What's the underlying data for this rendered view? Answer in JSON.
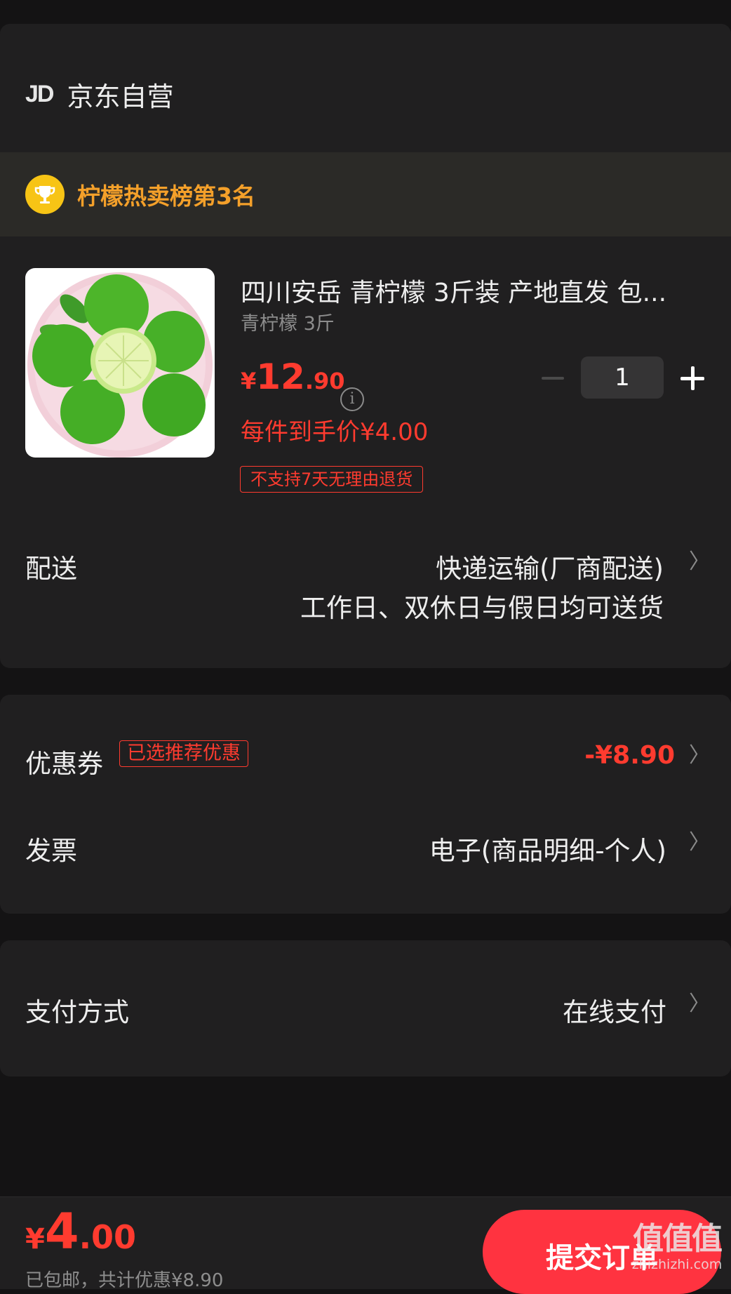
{
  "store": {
    "logo": "JD",
    "name": "京东自营"
  },
  "ranking": {
    "text": "柠檬热卖榜第3名"
  },
  "product": {
    "image_alt": "青柠檬",
    "title": "四川安岳 青柠檬 3斤装 产地直发 包...",
    "spec": "青柠檬 3斤",
    "price_symbol": "¥",
    "price_int": "12",
    "price_dec": ".90",
    "unit_price": "每件到手价¥4.00",
    "return_tag": "不支持7天无理由退货",
    "quantity": "1"
  },
  "delivery": {
    "label": "配送",
    "method": "快递运输(厂商配送)",
    "schedule": "工作日、双休日与假日均可送货"
  },
  "coupon": {
    "label": "优惠券",
    "tag": "已选推荐优惠",
    "value": "-¥8.90"
  },
  "invoice": {
    "label": "发票",
    "value": "电子(商品明细-个人)"
  },
  "payment": {
    "label": "支付方式",
    "value": "在线支付"
  },
  "footer": {
    "total_symbol": "¥",
    "total_int": "4",
    "total_dec": ".00",
    "note": "已包邮，共计优惠¥8.90",
    "submit_label": "提交订单",
    "watermark_main": "值值值",
    "watermark_url": "zhizhizhi.com"
  },
  "colors": {
    "accent": "#ff3b2f",
    "rank": "#f4a02a",
    "gold": "#f7c415",
    "bg": "#141314",
    "card": "#201f20"
  }
}
